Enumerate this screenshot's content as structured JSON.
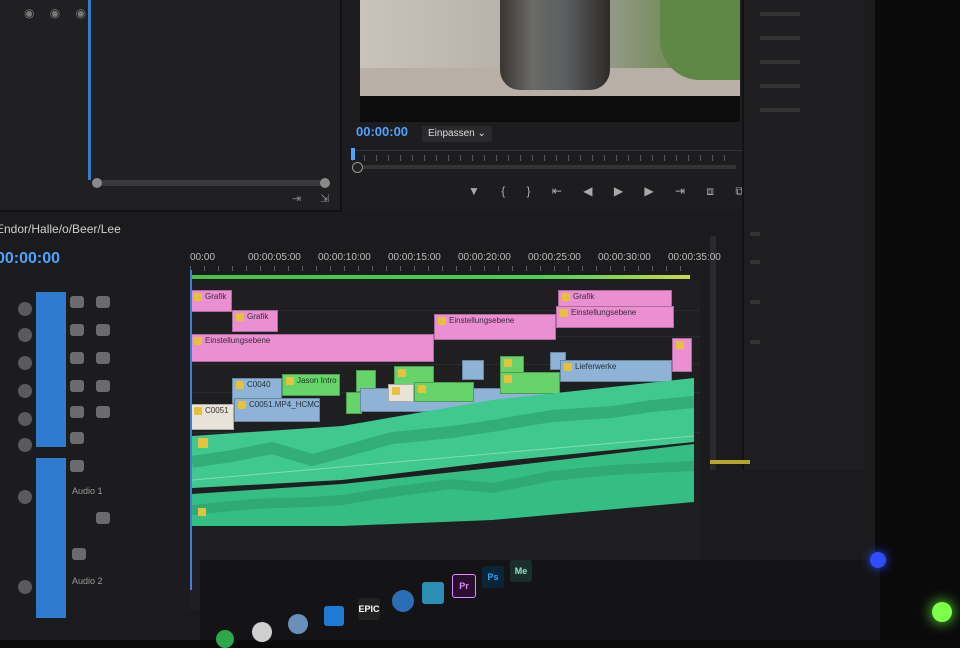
{
  "program_monitor": {
    "timecode": "00:00:00",
    "fit_label": "Einpassen",
    "fit_caret": "⌄",
    "transport_glyphs": "▼ { } ⇤ ◀ ▶ ▶ ⇥ ⧈ ⧉ ◎ ◎ ◎"
  },
  "source_panel": {
    "top_icons": "◉ ◉ ◉",
    "bottom_icons": "⇥ ⇲"
  },
  "sequence": {
    "title": "Endor/Halle/o/Beer/Lee",
    "timecode": "00:00:00",
    "ruler_labels": [
      "00:00",
      "00:00:05:00",
      "00:00:10:00",
      "00:00:15:00",
      "00:00:20:00",
      "00:00:25:00",
      "00:00:30:00",
      "00:00:35:00"
    ]
  },
  "tracks": {
    "audio1_label": "Audio 1",
    "audio2_label": "Audio 2"
  },
  "clips": {
    "v4_a": "Grafik",
    "v4_b": "Grafik",
    "v3_a": "Grafik",
    "v2_a": "Einstellungsebene",
    "v2_b": "Einstellungsebene",
    "v2_c": "Einstellungsebene",
    "v1_a": "C0040",
    "v1_b": "Jason Intro",
    "v1_c": "Jason Intro",
    "v1_d": "Lieferwerke",
    "v0_a": "C0051",
    "v0_b": "C0051.MP4_HCMC"
  },
  "taskbar": {
    "epic": "EPIC",
    "pr": "Pr",
    "ps": "Ps",
    "me": "Me"
  },
  "colors": {
    "accent_blue": "#4fa3ff",
    "clip_pink": "#ea8fd2",
    "clip_green": "#67d36b",
    "audio_green": "#3fc98e"
  }
}
